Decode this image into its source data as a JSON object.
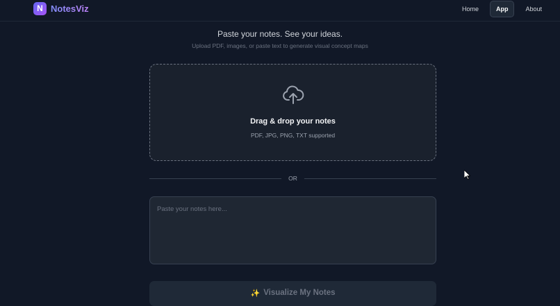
{
  "brand": {
    "logo_letter": "N",
    "name": "NotesViz"
  },
  "nav": {
    "links": [
      "Home",
      "App",
      "About"
    ],
    "active": "App"
  },
  "hero": {
    "headline": "Paste your notes. See your ideas.",
    "subline": "Upload PDF, images, or paste text to generate visual concept maps"
  },
  "dropzone": {
    "icon": "cloud-upload-icon",
    "title": "Drag & drop your notes",
    "formats": "PDF, JPG, PNG, TXT supported"
  },
  "divider": {
    "label": "OR"
  },
  "notes_input": {
    "placeholder": "Paste your notes here...",
    "value": ""
  },
  "visualize_button": {
    "icon": "sparkles-icon",
    "icon_glyph": "✨",
    "label": "Visualize My Notes"
  },
  "colors": {
    "background": "#111827",
    "accent_start": "#6366f1",
    "accent_end": "#a855f7"
  }
}
